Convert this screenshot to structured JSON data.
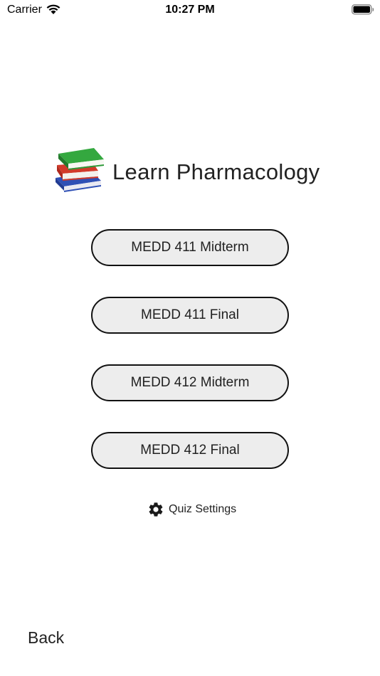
{
  "status_bar": {
    "carrier": "Carrier",
    "time": "10:27 PM"
  },
  "header": {
    "icon": "books-icon",
    "title": "Learn Pharmacology"
  },
  "quizzes": [
    {
      "label": "MEDD 411 Midterm"
    },
    {
      "label": "MEDD 411 Final"
    },
    {
      "label": "MEDD 412 Midterm"
    },
    {
      "label": "MEDD 412 Final"
    }
  ],
  "settings": {
    "icon": "gear-icon",
    "label": "Quiz Settings"
  },
  "nav": {
    "back_label": "Back"
  },
  "colors": {
    "button_fill": "#ededed",
    "button_border": "#111111",
    "book_green": "#2e9a3a",
    "book_red": "#d23a2a",
    "book_blue": "#2e4fb5"
  }
}
